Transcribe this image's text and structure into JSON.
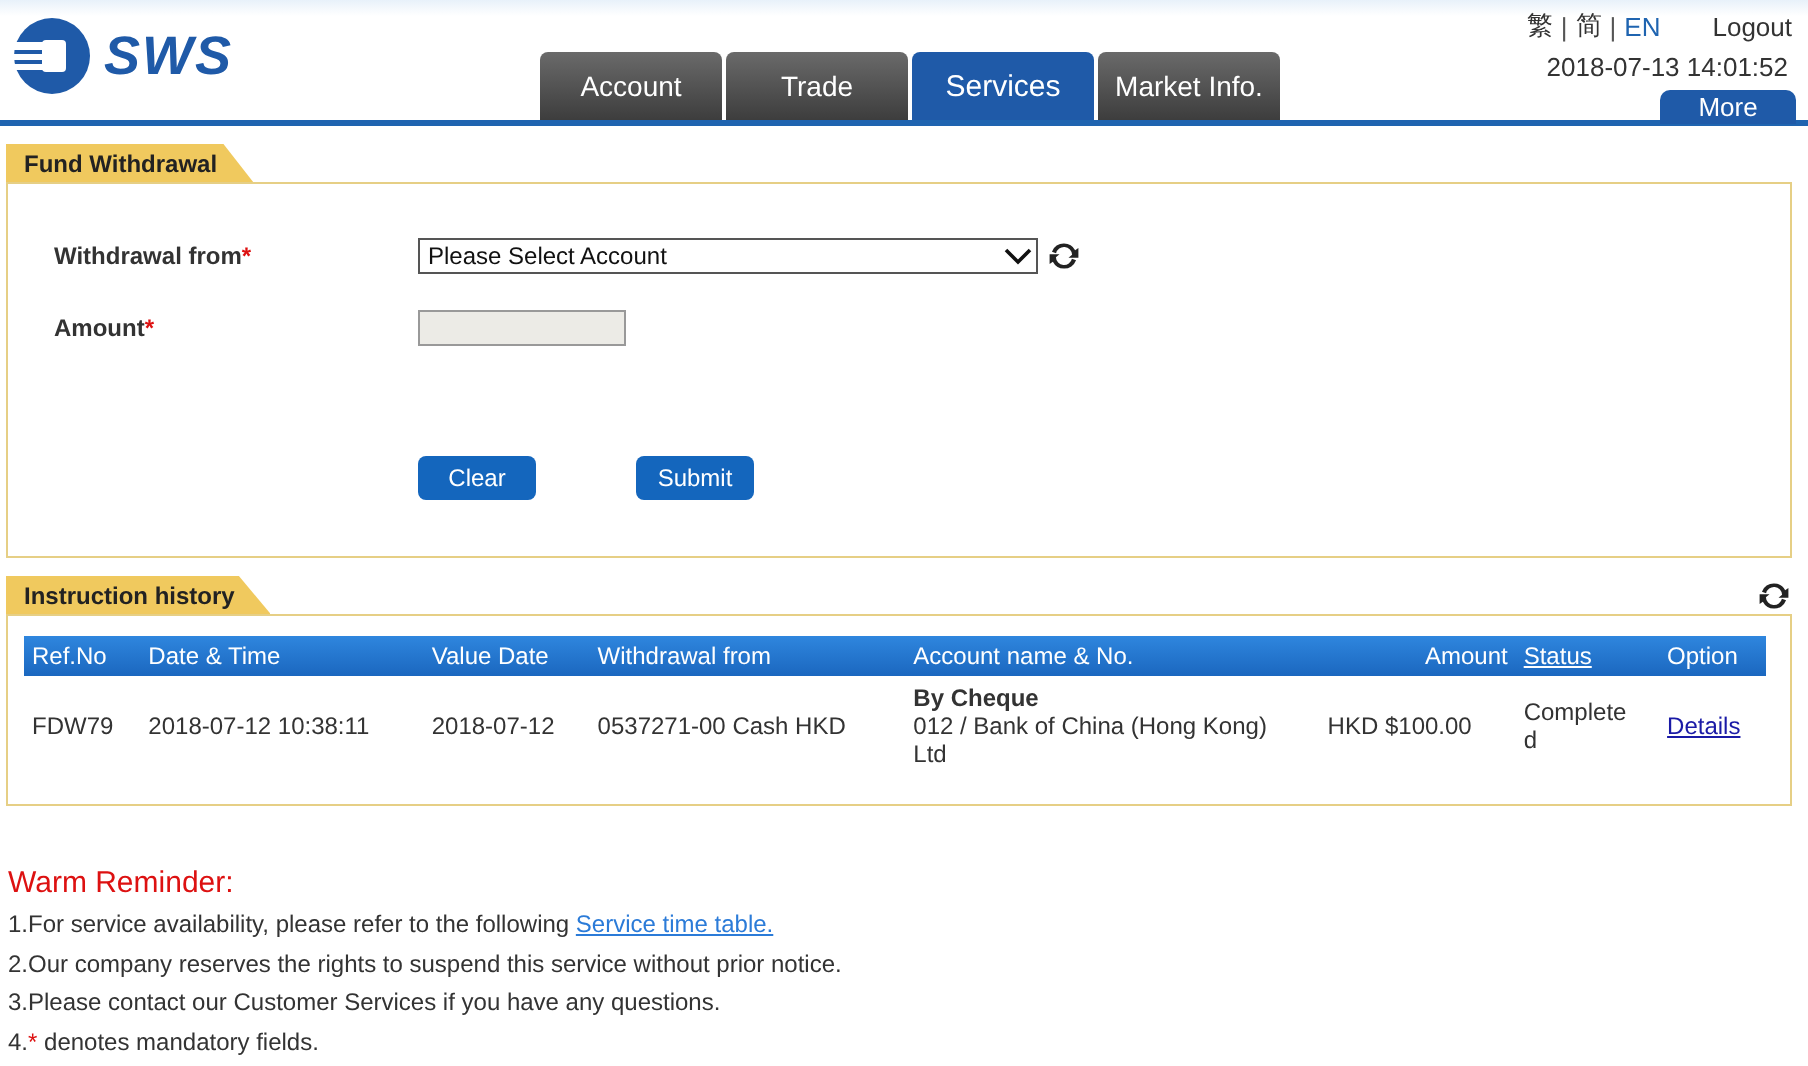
{
  "header": {
    "logo_text": "SWS",
    "languages": [
      {
        "label": "繁",
        "selected": false
      },
      {
        "label": "简",
        "selected": false
      },
      {
        "label": "EN",
        "selected": true
      }
    ],
    "separator": "|",
    "logout": "Logout",
    "datetime": "2018-07-13 14:01:52",
    "more": "More"
  },
  "tabs": [
    {
      "label": "Account",
      "selected": false
    },
    {
      "label": "Trade",
      "selected": false
    },
    {
      "label": "Services",
      "selected": true
    },
    {
      "label": "Market Info.",
      "selected": false
    }
  ],
  "fund_withdrawal": {
    "title": "Fund Withdrawal",
    "fields": [
      {
        "kind": "select",
        "label": "Withdrawal from",
        "required_mark": "*",
        "value": "Please Select Account"
      },
      {
        "kind": "input",
        "label": "Amount",
        "required_mark": "*",
        "disabled": true
      }
    ],
    "buttons": [
      "Clear",
      "Submit"
    ]
  },
  "instruction_history": {
    "title": "Instruction history",
    "columns": [
      {
        "label": "Ref.No",
        "link": false
      },
      {
        "label": "Date & Time",
        "link": false
      },
      {
        "label": "Value Date",
        "link": false
      },
      {
        "label": "Withdrawal from",
        "link": false
      },
      {
        "label": "Account name & No.",
        "link": false
      },
      {
        "label": "Amount",
        "link": false
      },
      {
        "label": "Status",
        "link": true
      },
      {
        "label": "Option",
        "link": false
      }
    ],
    "rows": [
      {
        "ref_no": "FDW79",
        "date_time": "2018-07-12 10:38:11",
        "value_date": "2018-07-12",
        "withdrawal_from": "0537271-00 Cash HKD",
        "account_method": "By Cheque",
        "account_name": "012 / Bank of China (Hong Kong) Ltd",
        "amount": "HKD $100.00",
        "status": "Completed",
        "option": "Details"
      }
    ]
  },
  "reminder": {
    "title": "Warm Reminder:",
    "items": [
      [
        {
          "kind": "text",
          "text": "1.For service availability, please refer to the following "
        },
        {
          "kind": "link",
          "text": "Service time table."
        }
      ],
      [
        {
          "kind": "text",
          "text": "2.Our company reserves the rights to suspend this service without prior notice."
        }
      ],
      [
        {
          "kind": "text",
          "text": "3.Please contact our Customer Services if you have any questions."
        }
      ],
      [
        {
          "kind": "text",
          "text": "4."
        },
        {
          "kind": "mark",
          "text": "*"
        },
        {
          "kind": "text",
          "text": " denotes mandatory fields."
        }
      ]
    ]
  }
}
